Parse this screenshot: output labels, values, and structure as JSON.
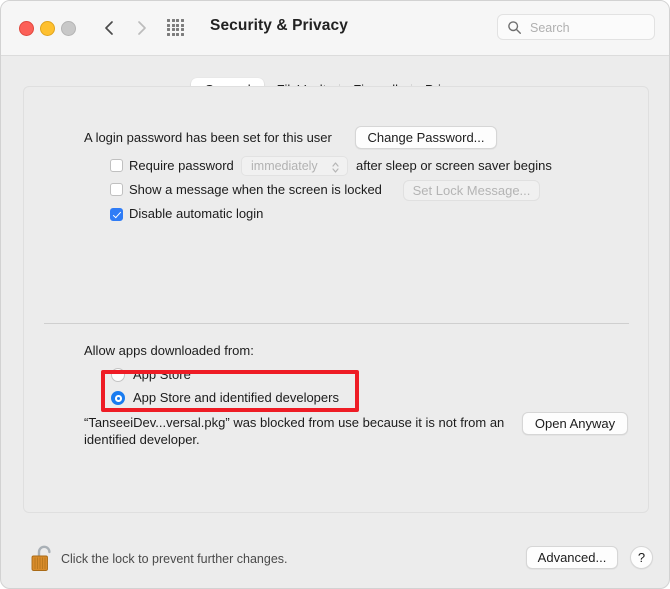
{
  "window": {
    "title": "Security & Privacy",
    "traffic_lights": {
      "close": "close-button",
      "minimize": "minimize-button",
      "zoom": "zoom-button"
    },
    "nav": {
      "back": "chevron-left-icon",
      "forward": "chevron-right-icon",
      "grid": "grid-icon"
    },
    "search": {
      "placeholder": "Search",
      "value": "",
      "icon": "search-icon"
    }
  },
  "tabs": [
    {
      "label": "General",
      "selected": true
    },
    {
      "label": "FileVault",
      "selected": false
    },
    {
      "label": "Firewall",
      "selected": false
    },
    {
      "label": "Privacy",
      "selected": false
    }
  ],
  "general": {
    "login_password_text": "A login password has been set for this user",
    "change_password_label": "Change Password...",
    "require_password": {
      "label": "Require password",
      "checked": false,
      "delay_value": "immediately",
      "suffix": "after sleep or screen saver begins",
      "stepper_icon": "chevron-updown-icon"
    },
    "show_message": {
      "label": "Show a message when the screen is locked",
      "checked": false,
      "button_label": "Set Lock Message..."
    },
    "disable_automatic_login": {
      "label": "Disable automatic login",
      "checked": true
    },
    "allow_apps_label": "Allow apps downloaded from:",
    "radios": [
      {
        "label": "App Store",
        "selected": false
      },
      {
        "label": "App Store and identified developers",
        "selected": true
      }
    ],
    "blocked_message": "“TanseeiDev...versal.pkg” was blocked from use because it is not from an identified developer.",
    "open_anyway_label": "Open Anyway"
  },
  "footer": {
    "lock_icon": "padlock-open-icon",
    "lock_status_text": "Click the lock to prevent further changes.",
    "advanced_label": "Advanced...",
    "help_label": "?"
  },
  "annotation": {
    "color": "#ee1c25",
    "target": "radio-group-allow-apps"
  },
  "colors": {
    "accent": "#2f7cf6",
    "radio_accent": "#1a7cf0",
    "annotation": "#ee1c25",
    "window_bg": "#ececec",
    "titlebar_bg": "#f6f6f6"
  }
}
